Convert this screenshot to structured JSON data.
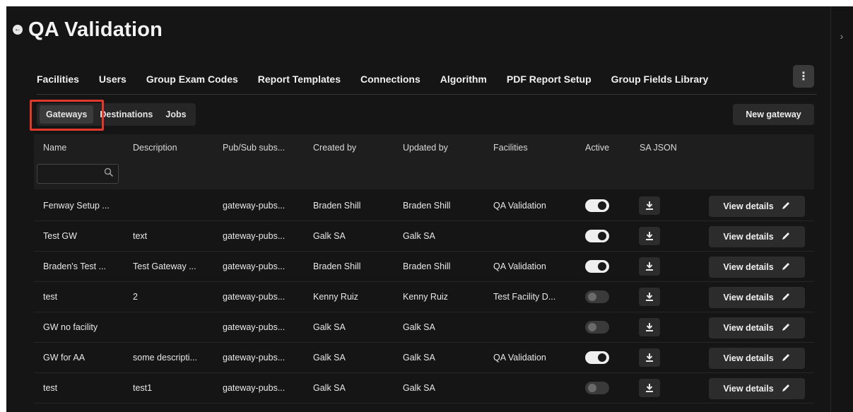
{
  "page": {
    "title": "QA Validation"
  },
  "topnav": [
    "Facilities",
    "Users",
    "Group Exam Codes",
    "Report Templates",
    "Connections",
    "Algorithm",
    "PDF Report Setup",
    "Group Fields Library"
  ],
  "more_label": "⋮",
  "subtabs": [
    "Gateways",
    "Destinations",
    "Jobs"
  ],
  "new_gateway_label": "New gateway",
  "columns": [
    "Name",
    "Description",
    "Pub/Sub subs...",
    "Created by",
    "Updated by",
    "Facilities",
    "Active",
    "SA JSON"
  ],
  "filter": {
    "name_value": ""
  },
  "view_details_label": "View details",
  "rows": [
    {
      "name": "Fenway Setup ...",
      "description": "",
      "pubsub": "gateway-pubs...",
      "created_by": "Braden Shill",
      "updated_by": "Braden Shill",
      "facilities": "QA Validation",
      "active": true
    },
    {
      "name": "Test GW",
      "description": "text",
      "pubsub": "gateway-pubs...",
      "created_by": "Galk SA",
      "updated_by": "Galk SA",
      "facilities": "",
      "active": true
    },
    {
      "name": "Braden's Test ...",
      "description": "Test Gateway ...",
      "pubsub": "gateway-pubs...",
      "created_by": "Braden Shill",
      "updated_by": "Braden Shill",
      "facilities": "QA Validation",
      "active": true
    },
    {
      "name": "test",
      "description": "2",
      "pubsub": "gateway-pubs...",
      "created_by": "Kenny Ruiz",
      "updated_by": "Kenny Ruiz",
      "facilities": "Test Facility D...",
      "active": false
    },
    {
      "name": "GW no facility",
      "description": "",
      "pubsub": "gateway-pubs...",
      "created_by": "Galk SA",
      "updated_by": "Galk SA",
      "facilities": "",
      "active": false
    },
    {
      "name": "GW for AA",
      "description": "some descripti...",
      "pubsub": "gateway-pubs...",
      "created_by": "Galk SA",
      "updated_by": "Galk SA",
      "facilities": "QA Validation",
      "active": true
    },
    {
      "name": "test",
      "description": "test1",
      "pubsub": "gateway-pubs...",
      "created_by": "Galk SA",
      "updated_by": "Galk SA",
      "facilities": "",
      "active": false
    }
  ]
}
